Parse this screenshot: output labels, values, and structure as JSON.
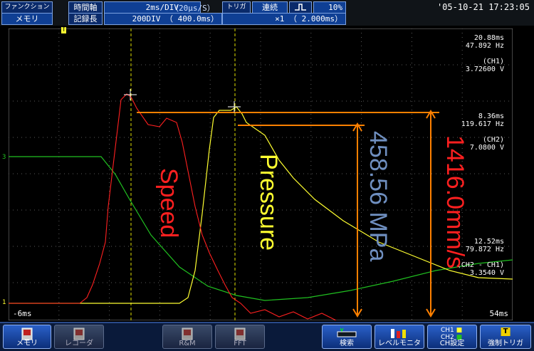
{
  "header": {
    "function_label": "ファンクション",
    "function_value": "メモリ",
    "timebase_label": "時間軸",
    "timebase_value": "2ms/DIV",
    "sample_rate": "（20μs/S）",
    "trigger_label": "トリガ",
    "trigger_mode": "連続",
    "trigger_icon": "trigger-edge-icon",
    "pretrigger": "10%",
    "record_label": "記録長",
    "record_value": "200DIV （ 400.0ms）",
    "zoom_value": "×1 （ 2.000ms）",
    "datetime": "'05-10-21 17:23:05"
  },
  "scope": {
    "time_left": "-6ms",
    "time_right": "54ms",
    "ch_marker_3": "3",
    "ch_marker_1": "1",
    "trigger_marker": "T",
    "cursor_a_time": "20.88ms",
    "cursor_a_freq": "47.892 Hz",
    "cursor_a_ch": "(CH1)",
    "cursor_a_value": "3.72600 V",
    "cursor_b_time": "8.36ms",
    "cursor_b_freq": "119.617 Hz",
    "cursor_b_ch": "(CH2)",
    "cursor_b_value": "7.0800 V",
    "diff_time": "12.52ms",
    "diff_freq": "79.872 Hz",
    "diff_ch": "(CH2 - CH1)",
    "diff_value": "3.3540 V"
  },
  "annotations": {
    "speed": "Speed",
    "pressure": "Pressure",
    "pressure_value": "458.56 MPa",
    "speed_value": "1416.0mm/s"
  },
  "colors": {
    "speed": "#ff2020",
    "pressure": "#ffff30",
    "green_trace": "#20c020",
    "orange": "#ff8000",
    "pressure_value": "#6f8fc0"
  },
  "footer": {
    "memory": "メモリ",
    "recorder": "レコーダ",
    "rm": "R&M",
    "fft": "FFT",
    "search": "検索",
    "level_monitor": "レベルモニタ",
    "ch_setting": "CH設定",
    "ch1": "CH1",
    "ch2": "CH2",
    "forced_trigger": "強制トリガ",
    "forced_trigger_icon": "T"
  }
}
